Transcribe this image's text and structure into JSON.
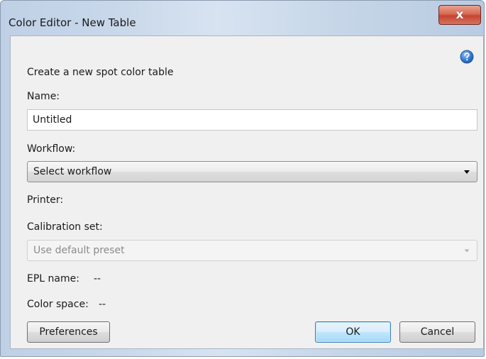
{
  "window": {
    "title": "Color Editor - New Table",
    "close_symbol": "x"
  },
  "form": {
    "heading": "Create a new spot color table",
    "name_label": "Name:",
    "name_value": "Untitled",
    "workflow_label": "Workflow:",
    "workflow_selected": "Select workflow",
    "printer_label": "Printer:",
    "calibration_label": "Calibration set:",
    "calibration_selected": "Use default preset",
    "epl_label": "EPL name:",
    "epl_value": "--",
    "color_space_label": "Color space:",
    "color_space_value": "--"
  },
  "buttons": {
    "preferences": "Preferences",
    "ok": "OK",
    "cancel": "Cancel"
  },
  "icons": {
    "help": "help-icon",
    "close": "close-icon",
    "dropdown": "chevron-down-icon"
  },
  "colors": {
    "accent": "#3c7fb1",
    "close_button": "#c54431",
    "help_icon": "#3d7fd4"
  }
}
